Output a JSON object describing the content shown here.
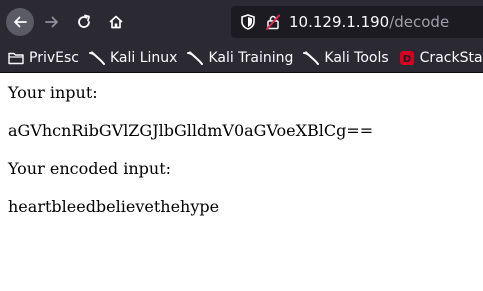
{
  "browser": {
    "url_host": "10.129.1.190",
    "url_path": "/decode",
    "bookmarks": [
      {
        "label": "PrivEsc",
        "icon": "folder-icon"
      },
      {
        "label": "Kali Linux",
        "icon": "kali-dragon-icon"
      },
      {
        "label": "Kali Training",
        "icon": "kali-dragon-icon"
      },
      {
        "label": "Kali Tools",
        "icon": "kali-dragon-icon"
      },
      {
        "label": "CrackStat",
        "icon": "crackstation-icon"
      }
    ],
    "colors": {
      "chrome_bg": "#2b2a33",
      "urlbar_bg": "#1c1b22",
      "crackstation_red": "#d70022"
    }
  },
  "page": {
    "input_label": "Your input:",
    "input_value": "aGVhcnRibGVlZGJlbGlldmV0aGVoeXBlCg==",
    "encoded_label": "Your encoded input:",
    "encoded_value": "heartbleedbelievethehype"
  }
}
